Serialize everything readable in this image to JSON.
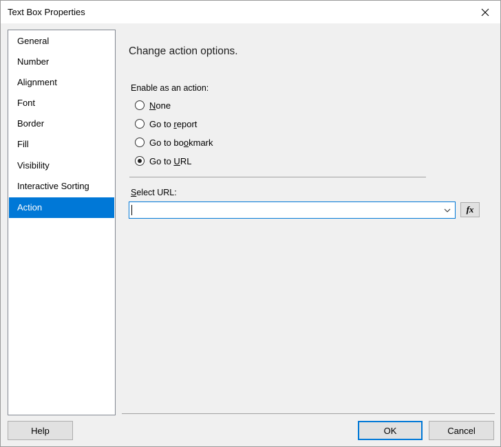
{
  "window": {
    "title": "Text Box Properties"
  },
  "sidebar": {
    "items": [
      {
        "label": "General"
      },
      {
        "label": "Number"
      },
      {
        "label": "Alignment"
      },
      {
        "label": "Font"
      },
      {
        "label": "Border"
      },
      {
        "label": "Fill"
      },
      {
        "label": "Visibility"
      },
      {
        "label": "Interactive Sorting"
      },
      {
        "label": "Action",
        "selected": true
      }
    ]
  },
  "main": {
    "heading": "Change action options.",
    "action_group": {
      "label": "Enable as an action:",
      "options": [
        {
          "before": "",
          "key": "N",
          "after": "one",
          "checked": false
        },
        {
          "before": "Go to ",
          "key": "r",
          "after": "eport",
          "checked": false
        },
        {
          "before": "Go to bo",
          "key": "o",
          "after": "kmark",
          "checked": false
        },
        {
          "before": "Go to ",
          "key": "U",
          "after": "RL",
          "checked": true
        }
      ]
    },
    "url": {
      "label_key": "S",
      "label_rest": "elect URL:",
      "value": "",
      "expression_button": "fx"
    }
  },
  "footer": {
    "help_label": "Help",
    "ok_label": "OK",
    "cancel_label": "Cancel"
  },
  "colors": {
    "accent": "#0078d7",
    "window_bg": "#f0f0f0",
    "button_bg": "#e1e1e1"
  }
}
